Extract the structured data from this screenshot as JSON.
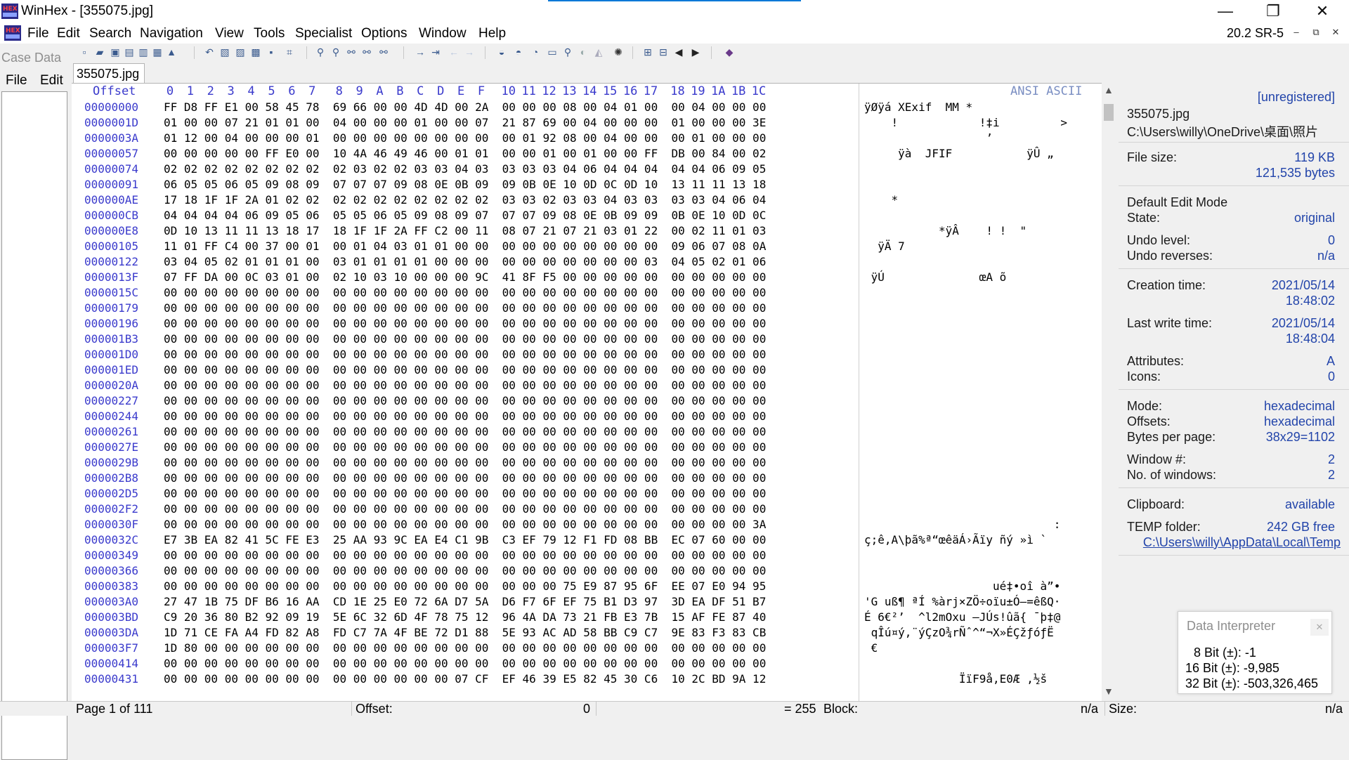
{
  "window": {
    "title": "WinHex - [355075.jpg]",
    "minimize": "—",
    "restore": "❐",
    "close": "✕"
  },
  "menu": {
    "items": [
      "File",
      "Edit",
      "Search",
      "Navigation",
      "View",
      "Tools",
      "Specialist",
      "Options",
      "Window",
      "Help"
    ],
    "version": "20.2 SR-5",
    "mdi_min": "–",
    "mdi_restore": "⧉",
    "mdi_close": "✕"
  },
  "case_panel": {
    "header": "Case Data",
    "file": "File",
    "edit": "Edit"
  },
  "document_tab": "355075.jpg",
  "hex_header": {
    "offset_label": "Offset",
    "columns": [
      "0",
      "1",
      "2",
      "3",
      "4",
      "5",
      "6",
      "7",
      "8",
      "9",
      "A",
      "B",
      "C",
      "D",
      "E",
      "F",
      "10",
      "11",
      "12",
      "13",
      "14",
      "15",
      "16",
      "17",
      "18",
      "19",
      "1A",
      "1B",
      "1C"
    ],
    "ansi_label": "ANSI ASCII"
  },
  "hex_rows": [
    {
      "offset": "00000000",
      "hex": "FF D8 FF E1 00 58 45 78  69 66 00 00 4D 4D 00 2A  00 00 00 08 00 04 01 00  00 04 00 00 00",
      "ascii": "ÿØÿá XExif  MM *"
    },
    {
      "offset": "0000001D",
      "hex": "01 00 00 07 21 01 01 00  04 00 00 00 01 00 00 07  21 87 69 00 04 00 00 00  01 00 00 00 3E",
      "ascii": "    !            !‡i         >"
    },
    {
      "offset": "0000003A",
      "hex": "01 12 00 04 00 00 00 01  00 00 00 00 00 00 00 00  00 01 92 08 00 04 00 00  00 01 00 00 00",
      "ascii": "                  ’"
    },
    {
      "offset": "00000057",
      "hex": "00 00 00 00 00 FF E0 00  10 4A 46 49 46 00 01 01  00 00 01 00 01 00 00 FF  DB 00 84 00 02",
      "ascii": "     ÿà  JFIF           ÿÛ „"
    },
    {
      "offset": "00000074",
      "hex": "02 02 02 02 02 02 02 02  02 03 02 02 03 03 04 03  03 03 03 04 06 04 04 04  04 04 06 09 05",
      "ascii": ""
    },
    {
      "offset": "00000091",
      "hex": "06 05 05 06 05 09 08 09  07 07 07 09 08 0E 0B 09  09 0B 0E 10 0D 0C 0D 10  13 11 11 13 18",
      "ascii": ""
    },
    {
      "offset": "000000AE",
      "hex": "17 18 1F 1F 2A 01 02 02  02 02 02 02 02 02 02 02  03 03 02 03 03 04 03 03  03 03 04 06 04",
      "ascii": "    *"
    },
    {
      "offset": "000000CB",
      "hex": "04 04 04 04 06 09 05 06  05 05 06 05 09 08 09 07  07 07 09 08 0E 0B 09 09  0B 0E 10 0D 0C",
      "ascii": ""
    },
    {
      "offset": "000000E8",
      "hex": "0D 10 13 11 11 13 18 17  18 1F 1F 2A FF C2 00 11  08 07 21 07 21 03 01 22  00 02 11 01 03",
      "ascii": "           *ÿÂ    ! !  \""
    },
    {
      "offset": "00000105",
      "hex": "11 01 FF C4 00 37 00 01  00 01 04 03 01 01 00 00  00 00 00 00 00 00 00 00  09 06 07 08 0A",
      "ascii": "  ÿÄ 7"
    },
    {
      "offset": "00000122",
      "hex": "03 04 05 02 01 01 01 00  03 01 01 01 01 00 00 00  00 00 00 00 00 00 00 03  04 05 02 01 06",
      "ascii": ""
    },
    {
      "offset": "0000013F",
      "hex": "07 FF DA 00 0C 03 01 00  02 10 03 10 00 00 00 9C  41 8F F5 00 00 00 00 00  00 00 00 00 00",
      "ascii": " ÿÚ              œA õ"
    },
    {
      "offset": "0000015C",
      "hex": "00 00 00 00 00 00 00 00  00 00 00 00 00 00 00 00  00 00 00 00 00 00 00 00  00 00 00 00 00",
      "ascii": ""
    },
    {
      "offset": "00000179",
      "hex": "00 00 00 00 00 00 00 00  00 00 00 00 00 00 00 00  00 00 00 00 00 00 00 00  00 00 00 00 00",
      "ascii": ""
    },
    {
      "offset": "00000196",
      "hex": "00 00 00 00 00 00 00 00  00 00 00 00 00 00 00 00  00 00 00 00 00 00 00 00  00 00 00 00 00",
      "ascii": ""
    },
    {
      "offset": "000001B3",
      "hex": "00 00 00 00 00 00 00 00  00 00 00 00 00 00 00 00  00 00 00 00 00 00 00 00  00 00 00 00 00",
      "ascii": ""
    },
    {
      "offset": "000001D0",
      "hex": "00 00 00 00 00 00 00 00  00 00 00 00 00 00 00 00  00 00 00 00 00 00 00 00  00 00 00 00 00",
      "ascii": ""
    },
    {
      "offset": "000001ED",
      "hex": "00 00 00 00 00 00 00 00  00 00 00 00 00 00 00 00  00 00 00 00 00 00 00 00  00 00 00 00 00",
      "ascii": ""
    },
    {
      "offset": "0000020A",
      "hex": "00 00 00 00 00 00 00 00  00 00 00 00 00 00 00 00  00 00 00 00 00 00 00 00  00 00 00 00 00",
      "ascii": ""
    },
    {
      "offset": "00000227",
      "hex": "00 00 00 00 00 00 00 00  00 00 00 00 00 00 00 00  00 00 00 00 00 00 00 00  00 00 00 00 00",
      "ascii": ""
    },
    {
      "offset": "00000244",
      "hex": "00 00 00 00 00 00 00 00  00 00 00 00 00 00 00 00  00 00 00 00 00 00 00 00  00 00 00 00 00",
      "ascii": ""
    },
    {
      "offset": "00000261",
      "hex": "00 00 00 00 00 00 00 00  00 00 00 00 00 00 00 00  00 00 00 00 00 00 00 00  00 00 00 00 00",
      "ascii": ""
    },
    {
      "offset": "0000027E",
      "hex": "00 00 00 00 00 00 00 00  00 00 00 00 00 00 00 00  00 00 00 00 00 00 00 00  00 00 00 00 00",
      "ascii": ""
    },
    {
      "offset": "0000029B",
      "hex": "00 00 00 00 00 00 00 00  00 00 00 00 00 00 00 00  00 00 00 00 00 00 00 00  00 00 00 00 00",
      "ascii": ""
    },
    {
      "offset": "000002B8",
      "hex": "00 00 00 00 00 00 00 00  00 00 00 00 00 00 00 00  00 00 00 00 00 00 00 00  00 00 00 00 00",
      "ascii": ""
    },
    {
      "offset": "000002D5",
      "hex": "00 00 00 00 00 00 00 00  00 00 00 00 00 00 00 00  00 00 00 00 00 00 00 00  00 00 00 00 00",
      "ascii": ""
    },
    {
      "offset": "000002F2",
      "hex": "00 00 00 00 00 00 00 00  00 00 00 00 00 00 00 00  00 00 00 00 00 00 00 00  00 00 00 00 00",
      "ascii": ""
    },
    {
      "offset": "0000030F",
      "hex": "00 00 00 00 00 00 00 00  00 00 00 00 00 00 00 00  00 00 00 00 00 00 00 00  00 00 00 00 3A",
      "ascii": "                            :"
    },
    {
      "offset": "0000032C",
      "hex": "E7 3B EA 82 41 5C FE E3  25 AA 93 9C EA E4 C1 9B  C3 EF 79 12 F1 FD 08 BB  EC 07 60 00 00",
      "ascii": "ç;ê‚A\\þã%ª“œêäÁ›Ãïy ñý »ì `"
    },
    {
      "offset": "00000349",
      "hex": "00 00 00 00 00 00 00 00  00 00 00 00 00 00 00 00  00 00 00 00 00 00 00 00  00 00 00 00 00",
      "ascii": ""
    },
    {
      "offset": "00000366",
      "hex": "00 00 00 00 00 00 00 00  00 00 00 00 00 00 00 00  00 00 00 00 00 00 00 00  00 00 00 00 00",
      "ascii": ""
    },
    {
      "offset": "00000383",
      "hex": "00 00 00 00 00 00 00 00  00 00 00 00 00 00 00 00  00 00 00 75 E9 87 95 6F  EE 07 E0 94 95",
      "ascii": "                   ué‡•oî à”•"
    },
    {
      "offset": "000003A0",
      "hex": "27 47 1B 75 DF B6 16 AA  CD 1E 25 E0 72 6A D7 5A  D6 F7 6F EF 75 B1 D3 97  3D EA DF 51 B7",
      "ascii": "'G uß¶ ªÍ %àrj×ZÖ÷oïu±Ó—=êßQ·"
    },
    {
      "offset": "000003BD",
      "hex": "C9 20 36 80 B2 92 09 19  5E 6C 32 6D 4F 78 75 12  96 4A DA 73 21 FB E3 7B  15 AF FE 87 40",
      "ascii": "É 6€²’  ^l2mOxu –JÚs!ûã{ ¯þ‡@"
    },
    {
      "offset": "000003DA",
      "hex": "1D 71 CE FA A4 FD 82 A8  FD C7 7A 4F BE 72 D1 88  5E 93 AC AD 58 BB C9 C7  9E 83 F3 83 CB",
      "ascii": " qÎú¤ý‚¨ýÇzO¾rÑˆ^“¬­X»ÉÇžƒóƒË"
    },
    {
      "offset": "000003F7",
      "hex": "1D 80 00 00 00 00 00 00  00 00 00 00 00 00 00 00  00 00 00 00 00 00 00 00  00 00 00 00 00",
      "ascii": " €"
    },
    {
      "offset": "00000414",
      "hex": "00 00 00 00 00 00 00 00  00 00 00 00 00 00 00 00  00 00 00 00 00 00 00 00  00 00 00 00 00",
      "ascii": ""
    },
    {
      "offset": "00000431",
      "hex": "00 00 00 00 00 00 00 00  00 00 00 00 00 00 07 CF  EF 46 39 E5 82 45 30 C6  10 2C BD 9A 12",
      "ascii": "              ÏïF9å‚E0Æ ,½š"
    }
  ],
  "info_panel": {
    "registration": "[unregistered]",
    "filename": "355075.jpg",
    "path": "C:\\Users\\willy\\OneDrive\\桌面\\照片",
    "file_size_label": "File size:",
    "file_size_kb": "119 KB",
    "file_size_bytes": "121,535 bytes",
    "edit_mode_label": "Default Edit Mode",
    "state_label": "State:",
    "state_value": "original",
    "undo_level_label": "Undo level:",
    "undo_level_value": "0",
    "undo_reverses_label": "Undo reverses:",
    "undo_reverses_value": "n/a",
    "creation_label": "Creation time:",
    "creation_date": "2021/05/14",
    "creation_time": "18:48:02",
    "lastwrite_label": "Last write time:",
    "lastwrite_date": "2021/05/14",
    "lastwrite_time": "18:48:04",
    "attributes_label": "Attributes:",
    "attributes_value": "A",
    "icons_label": "Icons:",
    "icons_value": "0",
    "mode_label": "Mode:",
    "mode_value": "hexadecimal",
    "offsets_label": "Offsets:",
    "offsets_value": "hexadecimal",
    "bpp_label": "Bytes per page:",
    "bpp_value": "38x29=1102",
    "window_num_label": "Window #:",
    "window_num_value": "2",
    "num_windows_label": "No. of windows:",
    "num_windows_value": "2",
    "clipboard_label": "Clipboard:",
    "clipboard_value": "available",
    "temp_label": "TEMP folder:",
    "temp_value": "242 GB free",
    "temp_path": "C:\\Users\\willy\\AppData\\Local\\Temp"
  },
  "data_interpreter": {
    "title": "Data Interpreter",
    "close": "✕",
    "bit8": "8 Bit (±): -1",
    "bit16": "16 Bit (±): -9,985",
    "bit32": "32 Bit (±): -503,326,465"
  },
  "status": {
    "page": "Page 1 of 111",
    "offset_label": "Offset:",
    "offset_value": "0",
    "eq": "= 255",
    "block_label": "Block:",
    "block_value": "n/a",
    "size_label": "Size:",
    "size_value": "n/a"
  }
}
